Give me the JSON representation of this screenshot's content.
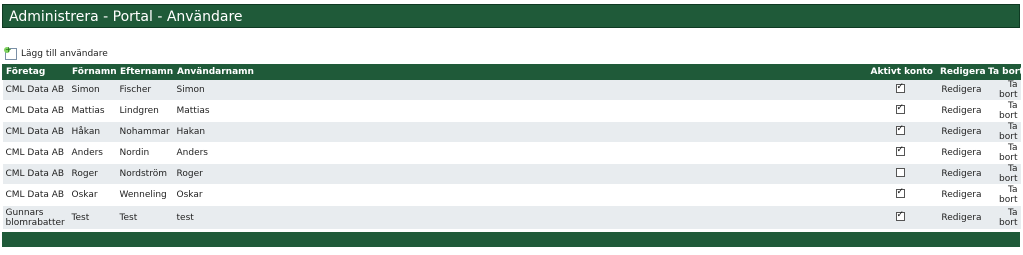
{
  "header": {
    "title": "Administrera - Portal - Användare"
  },
  "toolbar": {
    "add_user_label": "Lägg till användare",
    "add_icon": "add-user-icon"
  },
  "table": {
    "headers": {
      "company": "Företag",
      "firstname": "Förnamn",
      "lastname": "Efternamn",
      "username": "Användarnamn",
      "active": "Aktivt konto",
      "edit": "Redigera",
      "delete": "Ta bort"
    },
    "rows": [
      {
        "company": "CML Data AB",
        "firstname": "Simon",
        "lastname": "Fischer",
        "username": "Simon",
        "active": true,
        "edit": "Redigera",
        "delete": "Ta bort"
      },
      {
        "company": "CML Data AB",
        "firstname": "Mattias",
        "lastname": "Lindgren",
        "username": "Mattias",
        "active": true,
        "edit": "Redigera",
        "delete": "Ta bort"
      },
      {
        "company": "CML Data AB",
        "firstname": "Håkan",
        "lastname": "Nohammar",
        "username": "Hakan",
        "active": true,
        "edit": "Redigera",
        "delete": "Ta bort"
      },
      {
        "company": "CML Data AB",
        "firstname": "Anders",
        "lastname": "Nordin",
        "username": "Anders",
        "active": true,
        "edit": "Redigera",
        "delete": "Ta bort"
      },
      {
        "company": "CML Data AB",
        "firstname": "Roger",
        "lastname": "Nordström",
        "username": "Roger",
        "active": false,
        "edit": "Redigera",
        "delete": "Ta bort"
      },
      {
        "company": "CML Data AB",
        "firstname": "Oskar",
        "lastname": "Wenneling",
        "username": "Oskar",
        "active": true,
        "edit": "Redigera",
        "delete": "Ta bort"
      },
      {
        "company": "Gunnars blomrabatter",
        "firstname": "Test",
        "lastname": "Test",
        "username": "test",
        "active": true,
        "edit": "Redigera",
        "delete": "Ta bort"
      }
    ]
  },
  "colors": {
    "header_green": "#1f5a39",
    "row_alt": "#e8ecef"
  }
}
